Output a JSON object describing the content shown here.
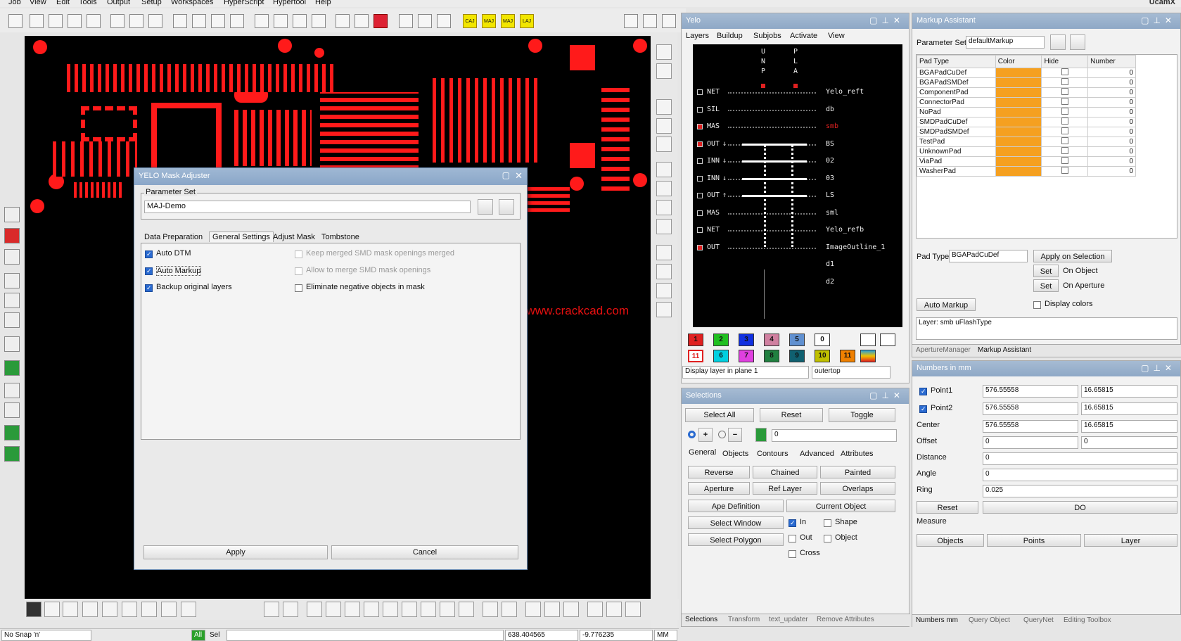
{
  "menu": [
    "Job",
    "View",
    "Edit",
    "Tools",
    "Output",
    "Setup",
    "Workspaces",
    "HyperScript",
    "Hypertool",
    "Help"
  ],
  "brand": "UcamX",
  "watermark": "http://www.crackcad.com",
  "toolbar": {
    "labels": [
      "CAJ",
      "MAJ",
      "MAJ",
      "LAJ"
    ]
  },
  "dialog": {
    "title": "YELO Mask Adjuster",
    "param_set_label": "Parameter Set",
    "param_set_value": "MAJ-Demo",
    "tabs": [
      "Data Preparation",
      "General Settings",
      "Adjust Mask",
      "Tombstone"
    ],
    "options": {
      "auto_dtm": "Auto DTM",
      "auto_markup": "Auto Markup",
      "backup": "Backup original layers",
      "keep_merged": "Keep merged SMD mask openings merged",
      "allow_merge": "Allow to merge SMD mask openings",
      "eliminate": "Eliminate negative objects in mask"
    },
    "apply": "Apply",
    "cancel": "Cancel"
  },
  "yelo": {
    "title": "Yelo",
    "menu": [
      "Layers",
      "Buildup",
      "Subjobs",
      "Activate",
      "View"
    ],
    "header_cols": [
      "U N P",
      "P L A"
    ],
    "rows": [
      {
        "type": "NET",
        "name": "Yelo_reft",
        "arrow": ""
      },
      {
        "type": "SIL",
        "name": "db",
        "arrow": ""
      },
      {
        "type": "MAS",
        "name": "smb",
        "arrow": ""
      },
      {
        "type": "OUT",
        "name": "BS",
        "arrow": "↓"
      },
      {
        "type": "INN",
        "name": "02",
        "arrow": "↓"
      },
      {
        "type": "INN",
        "name": "03",
        "arrow": "↓"
      },
      {
        "type": "OUT",
        "name": "LS",
        "arrow": "↑"
      },
      {
        "type": "MAS",
        "name": "sml",
        "arrow": ""
      },
      {
        "type": "NET",
        "name": "Yelo_refb",
        "arrow": ""
      },
      {
        "type": "OUT",
        "name": "ImageOutline_1",
        "arrow": ""
      },
      {
        "type": "",
        "name": "d1",
        "arrow": ""
      },
      {
        "type": "",
        "name": "d2",
        "arrow": ""
      }
    ],
    "swatches1": [
      "1",
      "2",
      "3",
      "4",
      "5",
      "0"
    ],
    "swatches2": [
      "11",
      "6",
      "7",
      "8",
      "9",
      "10",
      "11"
    ],
    "swatch_colors": {
      "s1": "#e02020",
      "s2": "#20c020",
      "s3": "#1030e0",
      "s4": "#d080a0",
      "s5": "#6090d0",
      "s6": "#00d0e0",
      "s7": "#e040e0",
      "s8": "#208040",
      "s9": "#106070",
      "s10": "#c0c000",
      "s11": "#f08000"
    },
    "display_label": "Display layer in plane 1",
    "display_value": "outertop"
  },
  "selections": {
    "title": "Selections",
    "top_buttons": [
      "Select All",
      "Reset",
      "Toggle"
    ],
    "value": "0",
    "tabs": [
      "General",
      "Objects",
      "Contours",
      "Advanced",
      "Attributes"
    ],
    "grid": [
      [
        "Reverse",
        "Chained",
        "Painted"
      ],
      [
        "Aperture",
        "Ref Layer",
        "Overlaps"
      ]
    ],
    "ape_definition": "Ape Definition",
    "current_object": "Current Object",
    "select_window": "Select Window",
    "select_polygon": "Select Polygon",
    "checks": {
      "in": "In",
      "out": "Out",
      "cross": "Cross",
      "shape": "Shape",
      "object": "Object"
    }
  },
  "markup": {
    "title": "Markup Assistant",
    "param_set_label": "Parameter Set",
    "param_set_value": "defaultMarkup",
    "columns": [
      "Pad Type",
      "Color",
      "Hide",
      "Number"
    ],
    "rows": [
      {
        "pad": "BGAPadCuDef",
        "num": "0"
      },
      {
        "pad": "BGAPadSMDef",
        "num": "0"
      },
      {
        "pad": "ComponentPad",
        "num": "0"
      },
      {
        "pad": "ConnectorPad",
        "num": "0"
      },
      {
        "pad": "NoPad",
        "num": "0"
      },
      {
        "pad": "SMDPadCuDef",
        "num": "0"
      },
      {
        "pad": "SMDPadSMDef",
        "num": "0"
      },
      {
        "pad": "TestPad",
        "num": "0"
      },
      {
        "pad": "UnknownPad",
        "num": "0"
      },
      {
        "pad": "ViaPad",
        "num": "0"
      },
      {
        "pad": "WasherPad",
        "num": "0"
      }
    ],
    "row_color": "#f5a020",
    "pad_type_label": "Pad Type",
    "pad_type_value": "BGAPadCuDef",
    "apply_selection": "Apply on Selection",
    "set": "Set",
    "on_object": "On Object",
    "on_aperture": "On Aperture",
    "auto_markup": "Auto Markup",
    "display_colors": "Display colors",
    "layer_info": "Layer: smb uFlashType",
    "bottom_tabs": [
      "ApertureManager",
      "Markup Assistant"
    ]
  },
  "numbers": {
    "title": "Numbers in mm",
    "point1": "Point1",
    "p1x": "576.55558",
    "p1y": "16.65815",
    "point2": "Point2",
    "p2x": "576.55558",
    "p2y": "16.65815",
    "center": "Center",
    "cx": "576.55558",
    "cy": "16.65815",
    "offset": "Offset",
    "ox": "0",
    "oy": "0",
    "distance": "Distance",
    "dv": "0",
    "angle": "Angle",
    "av": "0",
    "ring": "Ring",
    "rv": "0.025",
    "reset": "Reset",
    "do": "DO",
    "measure": "Measure",
    "objects": "Objects",
    "points": "Points",
    "layer": "Layer"
  },
  "status": {
    "snap": "No Snap 'n'",
    "all": "All",
    "sel": "Sel",
    "x": "638.404565",
    "y": "-9.776235",
    "unit": "MM"
  },
  "bottom_tabs_mid": [
    "Selections",
    "Transform",
    "text_updater",
    "Remove Attributes"
  ],
  "bottom_tabs_right": [
    "Numbers mm",
    "Query Object",
    "QueryNet",
    "Editing Toolbox"
  ]
}
